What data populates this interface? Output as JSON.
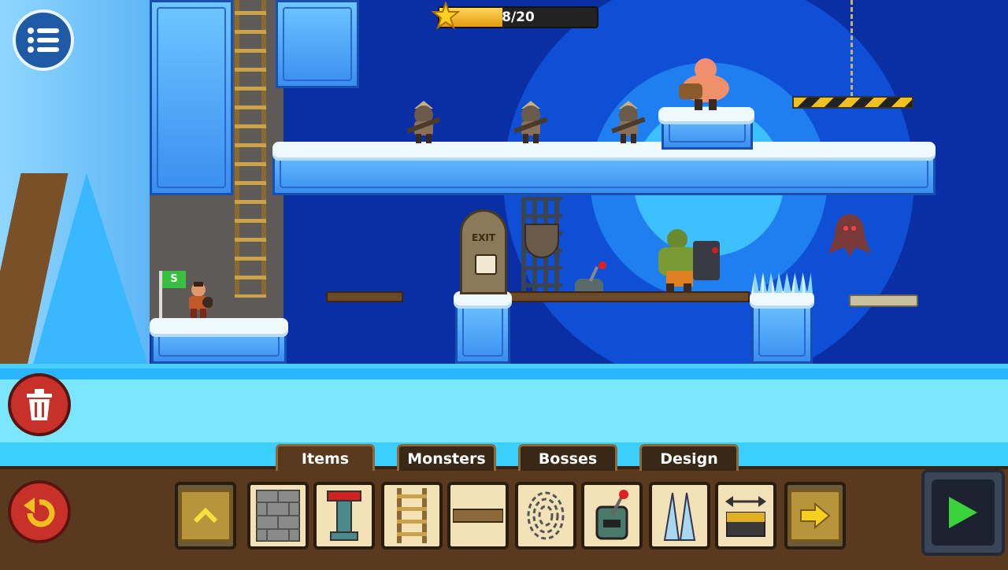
{
  "hud": {
    "star_progress_text": "8/20",
    "star_progress_fraction": 0.4,
    "menu_icon": "menu-list-icon"
  },
  "level": {
    "exit_label": "EXIT",
    "flag_letter": "S"
  },
  "toolbar": {
    "tabs": [
      {
        "label": "Items",
        "active": true
      },
      {
        "label": "Monsters",
        "active": false
      },
      {
        "label": "Bosses",
        "active": false
      },
      {
        "label": "Design",
        "active": false
      }
    ],
    "items": [
      {
        "icon": "stone-block-icon"
      },
      {
        "icon": "red-pillar-icon"
      },
      {
        "icon": "ladder-icon"
      },
      {
        "icon": "wood-plank-icon"
      },
      {
        "icon": "fingerprint-icon"
      },
      {
        "icon": "lever-icon"
      },
      {
        "icon": "spikes-icon"
      },
      {
        "icon": "moving-platform-icon"
      }
    ]
  },
  "colors": {
    "accent_green": "#3ad43a",
    "progress_gold": "#f0b020",
    "trash_red": "#c8302a"
  }
}
